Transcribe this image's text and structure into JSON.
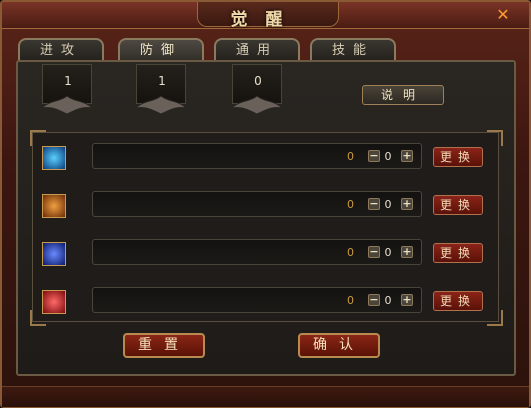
{
  "window": {
    "title": "觉醒",
    "close_icon": "close-icon"
  },
  "tabs": [
    {
      "label": "进攻",
      "active": false
    },
    {
      "label": "防御",
      "active": true
    },
    {
      "label": "通用",
      "active": false
    },
    {
      "label": "技能",
      "active": false
    }
  ],
  "banners": [
    {
      "value": "1"
    },
    {
      "value": "1"
    },
    {
      "value": "0"
    }
  ],
  "explain_button": "说明",
  "rows": [
    {
      "icon": "body-aura-icon",
      "value": "0",
      "count": "0",
      "swap_label": "更换"
    },
    {
      "icon": "warrior-icon",
      "value": "0",
      "count": "0",
      "swap_label": "更换"
    },
    {
      "icon": "sword-shield-icon",
      "value": "0",
      "count": "0",
      "swap_label": "更换"
    },
    {
      "icon": "red-shield-icon",
      "value": "0",
      "count": "0",
      "swap_label": "更换"
    }
  ],
  "stepper": {
    "minus": "−",
    "plus": "+"
  },
  "footer": {
    "reset_label": "重置",
    "confirm_label": "确认"
  },
  "colors": {
    "accent_gold": "#c89a40",
    "button_red": "#8a2418",
    "frame_border": "#8a5a34"
  }
}
